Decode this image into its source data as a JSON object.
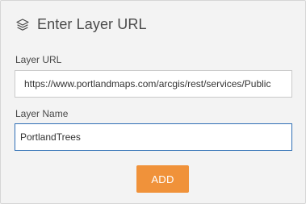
{
  "header": {
    "icon": "layers-icon",
    "title": "Enter Layer URL"
  },
  "fields": {
    "url": {
      "label": "Layer URL",
      "value": "https://www.portlandmaps.com/arcgis/rest/services/Public"
    },
    "name": {
      "label": "Layer Name",
      "value": "PortlandTrees"
    }
  },
  "actions": {
    "add_label": "ADD"
  },
  "colors": {
    "accent": "#f0923a",
    "focus_border": "#2f6fb5",
    "panel_bg": "#f3f3f3"
  }
}
